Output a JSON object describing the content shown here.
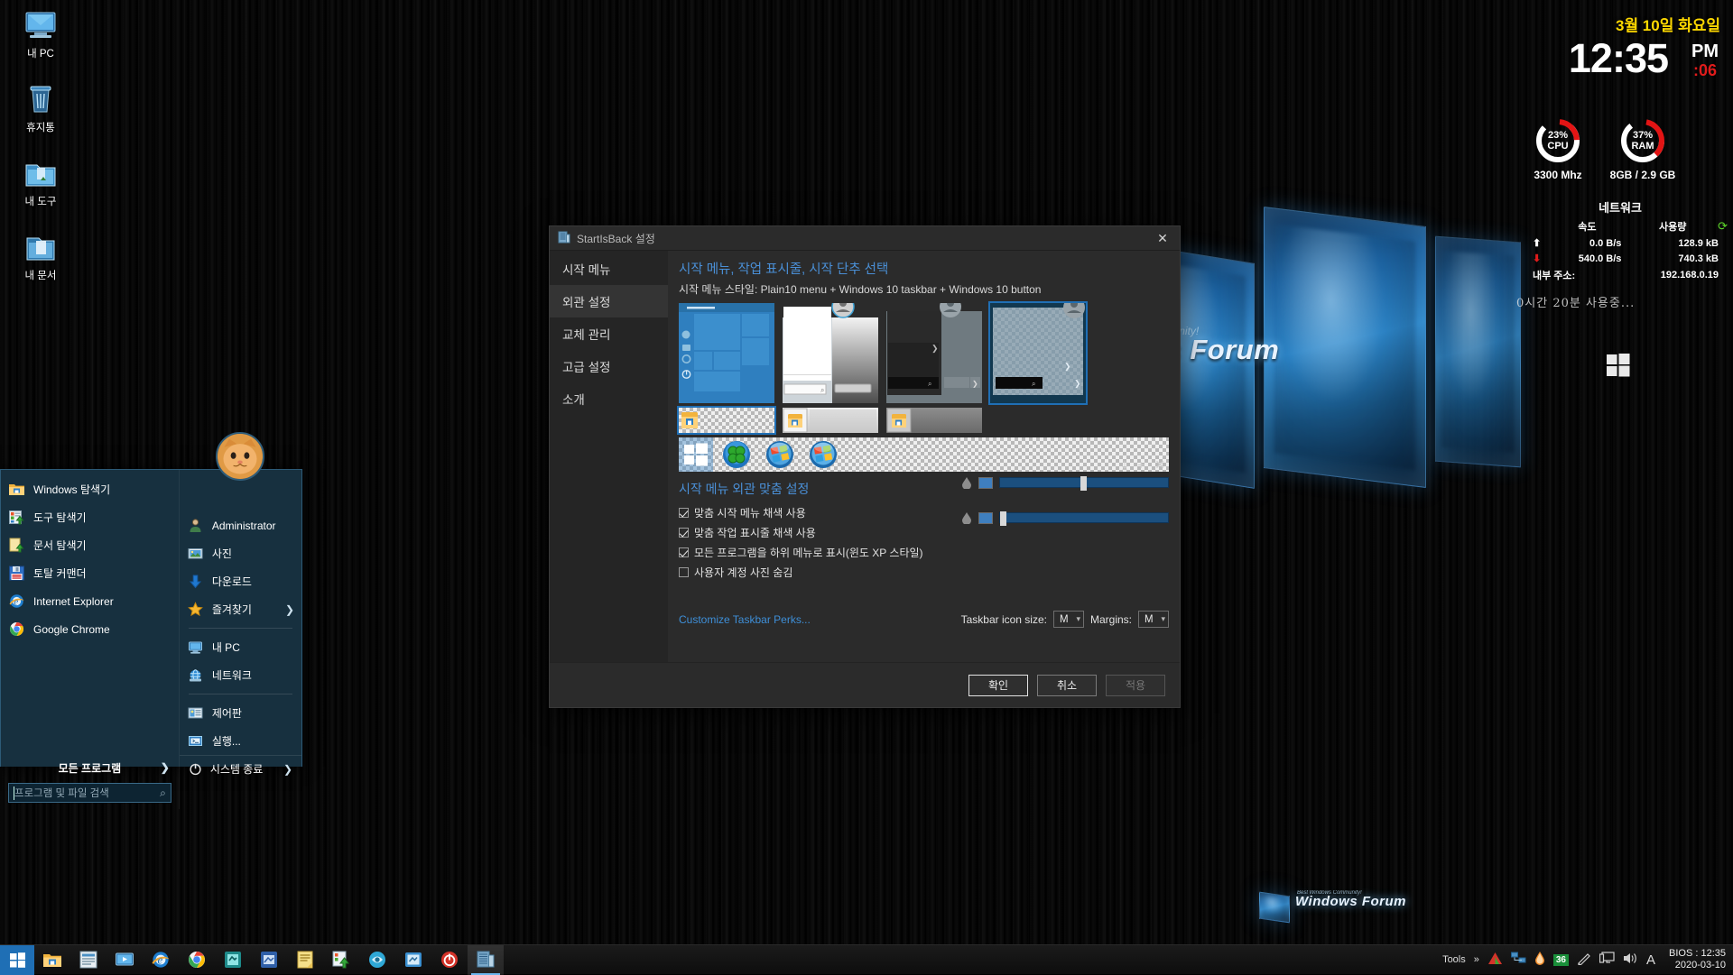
{
  "desktop": {
    "icons": [
      {
        "name": "내 PC",
        "icon": "computer-icon"
      },
      {
        "name": "휴지통",
        "icon": "recycle-bin-icon"
      },
      {
        "name": "내 도구",
        "icon": "folder-tools-icon"
      },
      {
        "name": "내 문서",
        "icon": "folder-documents-icon"
      }
    ],
    "wallpaper_logo": "Windows Forum",
    "wallpaper_sub": "Best Windows Community!"
  },
  "widgets": {
    "date": "3월 10일 화요일",
    "time": "12:35",
    "ampm": "PM",
    "seconds": ":06",
    "cpu": {
      "percent": "23%",
      "label": "CPU",
      "detail": "3300 Mhz",
      "value": 23
    },
    "ram": {
      "percent": "37%",
      "label": "RAM",
      "detail": "8GB /  2.9 GB",
      "value": 37
    },
    "network": {
      "title": "네트워크",
      "col_speed": "속도",
      "col_usage": "사용량",
      "up_speed": "0.0 B/s",
      "up_usage": "128.9 kB",
      "down_speed": "540.0 B/s",
      "down_usage": "740.3 kB",
      "addr_label": "내부 주소:",
      "addr_value": "192.168.0.19"
    },
    "uptime": "0시간 20분 사용중..."
  },
  "start_menu": {
    "left_items": [
      {
        "label": "Windows 탐색기",
        "icon": "folder-explorer-icon"
      },
      {
        "label": "도구 탐색기",
        "icon": "tools-explorer-icon"
      },
      {
        "label": "문서 탐색기",
        "icon": "documents-explorer-icon"
      },
      {
        "label": "토탈 커맨더",
        "icon": "floppy-disk-icon"
      },
      {
        "label": "Internet Explorer",
        "icon": "internet-explorer-icon"
      },
      {
        "label": "Google Chrome",
        "icon": "chrome-icon"
      }
    ],
    "right_items": [
      {
        "label": "Administrator",
        "icon": "user-icon",
        "arrow": false
      },
      {
        "label": "사진",
        "icon": "pictures-icon",
        "arrow": false
      },
      {
        "label": "다운로드",
        "icon": "download-icon",
        "arrow": false
      },
      {
        "label": "즐겨찾기",
        "icon": "favorites-star-icon",
        "arrow": true
      },
      {
        "label": "내 PC",
        "icon": "computer-icon",
        "arrow": false
      },
      {
        "label": "네트워크",
        "icon": "network-icon",
        "arrow": false
      },
      {
        "label": "제어판",
        "icon": "control-panel-icon",
        "arrow": false
      },
      {
        "label": "실행...",
        "icon": "run-icon",
        "arrow": false
      }
    ],
    "all_programs": "모든 프로그램",
    "search_placeholder": "프로그램 및 파일 검색",
    "search_value": "",
    "shutdown": "시스템 종료"
  },
  "dialog": {
    "title": "StartIsBack 설정",
    "nav": [
      {
        "label": "시작 메뉴",
        "selected": false
      },
      {
        "label": "외관 설정",
        "selected": true
      },
      {
        "label": "교체 관리",
        "selected": false
      },
      {
        "label": "고급 설정",
        "selected": false
      },
      {
        "label": "소개",
        "selected": false
      }
    ],
    "header": "시작 메뉴, 작업 표시줄, 시작 단추 선택",
    "subheader": "시작 메뉴 스타일: Plain10 menu + Windows 10 taskbar + Windows 10 button",
    "menu_previews": [
      {
        "name": "windows10-tiles-preview",
        "selected": false
      },
      {
        "name": "plain-white-preview",
        "selected": false
      },
      {
        "name": "dark-preview",
        "selected": false
      },
      {
        "name": "plain10-preview",
        "selected": true
      }
    ],
    "taskbar_previews": [
      {
        "name": "windows10-taskbar-preview",
        "selected": true
      },
      {
        "name": "aero-taskbar-preview",
        "selected": false
      },
      {
        "name": "grey-taskbar-preview",
        "selected": false
      }
    ],
    "orbs": [
      {
        "name": "windows10-orb",
        "selected": true
      },
      {
        "name": "green-clover-orb",
        "selected": false
      },
      {
        "name": "aero-orb",
        "selected": false
      },
      {
        "name": "vista-orb",
        "selected": false
      }
    ],
    "orb_tools": [
      {
        "name": "download-orb-icon",
        "glyph": "⤓"
      },
      {
        "name": "add-orb-icon",
        "glyph": "+"
      },
      {
        "name": "delete-orb-icon",
        "glyph": "✕"
      }
    ],
    "section_title": "시작 메뉴 외관 맞춤 설정",
    "checkboxes": [
      {
        "label": "맞춤 시작 메뉴 채색 사용",
        "checked": true
      },
      {
        "label": "맞춤 작업 표시줄 채색 사용",
        "checked": true
      },
      {
        "label": "모든 프로그램을 하위 메뉴로 표시(윈도 XP 스타일)",
        "checked": true
      },
      {
        "label": "사용자 계정 사진 숨김",
        "checked": false
      }
    ],
    "sliders": [
      {
        "name": "start-menu-color-slider",
        "value": 62,
        "swatch": "#3f7fbf"
      },
      {
        "name": "taskbar-color-slider",
        "value": 3,
        "swatch": "#3f7fbf"
      }
    ],
    "perks_link": "Customize Taskbar Perks...",
    "icon_size_label": "Taskbar icon size:",
    "icon_size_value": "M",
    "margins_label": "Margins:",
    "margins_value": "M",
    "buttons": [
      {
        "label": "확인",
        "style": "default"
      },
      {
        "label": "취소",
        "style": "normal"
      },
      {
        "label": "적용",
        "style": "disabled"
      }
    ]
  },
  "taskbar": {
    "start_button": "start-button",
    "items": [
      {
        "name": "taskbar-file-explorer",
        "icon": "folder-icon",
        "active": false
      },
      {
        "name": "taskbar-app-2",
        "icon": "notepad-icon",
        "active": false
      },
      {
        "name": "taskbar-app-3",
        "icon": "media-icon",
        "active": false
      },
      {
        "name": "taskbar-internet-explorer",
        "icon": "internet-explorer-icon",
        "active": false
      },
      {
        "name": "taskbar-chrome",
        "icon": "chrome-icon",
        "active": false
      },
      {
        "name": "taskbar-app-6",
        "icon": "app-teal-icon",
        "active": false
      },
      {
        "name": "taskbar-app-7",
        "icon": "app-blue-icon",
        "active": false
      },
      {
        "name": "taskbar-app-8",
        "icon": "app-yellow-icon",
        "active": false
      },
      {
        "name": "taskbar-app-9",
        "icon": "app-green-icon",
        "active": false
      },
      {
        "name": "taskbar-app-10",
        "icon": "app-cyan-icon",
        "active": false
      },
      {
        "name": "taskbar-app-11",
        "icon": "app-lightblue-icon",
        "active": false
      },
      {
        "name": "taskbar-power",
        "icon": "power-icon",
        "active": false
      },
      {
        "name": "taskbar-startisback",
        "icon": "startisback-icon",
        "active": true
      }
    ],
    "tray_tools": "Tools",
    "tray_overflow": "»",
    "tray_icons": [
      {
        "name": "antivirus-icon"
      },
      {
        "name": "network-connections-icon"
      },
      {
        "name": "water-drop-icon"
      },
      {
        "name": "temperature-36-icon",
        "label": "36"
      },
      {
        "name": "pen-icon"
      },
      {
        "name": "display-icon"
      },
      {
        "name": "volume-icon"
      },
      {
        "name": "font-icon"
      }
    ],
    "bios_time": "BIOS : 12:35",
    "bios_date": "2020-03-10"
  }
}
